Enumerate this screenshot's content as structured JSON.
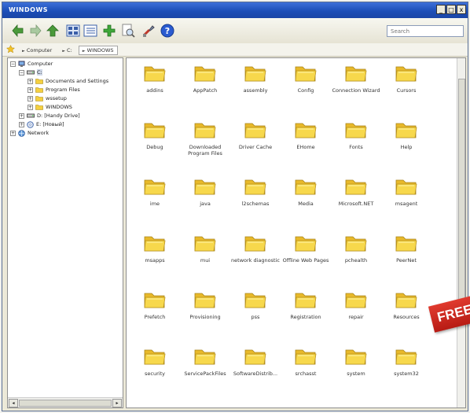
{
  "window": {
    "title": "WINDOWS",
    "minimize": "_",
    "maximize": "□",
    "close": "x"
  },
  "toolbar": {
    "search_placeholder": "Search"
  },
  "address": {
    "crumbs": [
      "Computer",
      "C:",
      "WINDOWS"
    ]
  },
  "tree": {
    "computer": "Computer",
    "c_drive": "C:",
    "documents": "Documents and Settings",
    "program_files": "Program Files",
    "wsetup": "wssetup",
    "windows": "WINDOWS",
    "d_drive": "D: [Handy Drive]",
    "e_drive": "E: [Новый]",
    "network": "Network"
  },
  "folders": [
    "addins",
    "AppPatch",
    "assembly",
    "Config",
    "Connection Wizard",
    "Cursors",
    "Debug",
    "Downloaded Program Files",
    "Driver Cache",
    "EHome",
    "Fonts",
    "Help",
    "ime",
    "java",
    "l2schemas",
    "Media",
    "Microsoft.NET",
    "msagent",
    "msapps",
    "mui",
    "network diagnostic",
    "Offline Web Pages",
    "pchealth",
    "PeerNet",
    "Prefetch",
    "Provisioning",
    "pss",
    "Registration",
    "repair",
    "Resources",
    "security",
    "ServicePackFiles",
    "SoftwareDistrib...",
    "srchasst",
    "system",
    "system32"
  ],
  "badge": "FREE",
  "colors": {
    "titlebar": "#1d4fb8",
    "folder": "#f5d040",
    "badge": "#c8241b"
  }
}
